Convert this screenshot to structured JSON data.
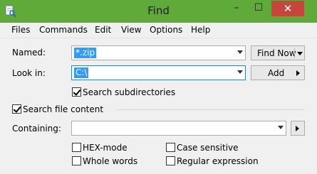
{
  "window": {
    "title": "Find",
    "icon": "find-app-icon",
    "controls": {
      "minimize": "–",
      "maximize": "☐",
      "close": "✕"
    }
  },
  "menu": [
    "Files",
    "Commands",
    "Edit",
    "View",
    "Options",
    "Help"
  ],
  "form": {
    "named_label": "Named:",
    "named_value": "*.zip",
    "lookin_label": "Look in:",
    "lookin_value": "C:\\",
    "search_subdirs_label": "Search subdirectories",
    "search_subdirs_checked": true,
    "search_file_content_label": "Search file content",
    "search_file_content_checked": true,
    "containing_label": "Containing:",
    "containing_value": "",
    "hex_mode_label": "HEX-mode",
    "whole_words_label": "Whole words",
    "case_sensitive_label": "Case sensitive",
    "regular_expression_label": "Regular expression"
  },
  "buttons": {
    "find_now": "Find Now",
    "add": "Add"
  },
  "colors": {
    "titlebar": "#60aa3a",
    "close": "#c7463c",
    "selection": "#3399ff"
  }
}
